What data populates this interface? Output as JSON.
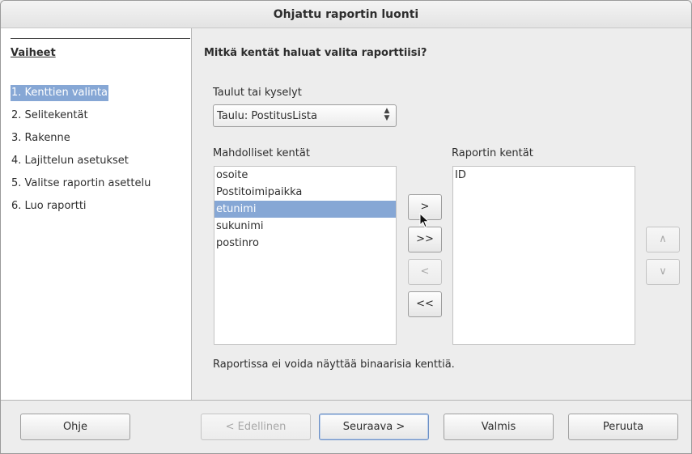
{
  "window": {
    "title": "Ohjattu raportin luonti"
  },
  "sidebar": {
    "title": "Vaiheet",
    "steps": [
      {
        "label": "1. Kenttien valinta",
        "active": true
      },
      {
        "label": "2. Selitekentät"
      },
      {
        "label": "3. Rakenne"
      },
      {
        "label": "4. Lajittelun asetukset"
      },
      {
        "label": "5. Valitse raportin asettelu"
      },
      {
        "label": "6. Luo raportti"
      }
    ]
  },
  "main": {
    "heading": "Mitkä kentät haluat valita raporttiisi?",
    "tables_label": "Taulut tai kyselyt",
    "tables_selected": "Taulu: PostitusLista",
    "available_label": "Mahdolliset kentät",
    "available_fields": [
      "osoite",
      "Postitoimipaikka",
      "etunimi",
      "sukunimi",
      "postinro"
    ],
    "available_selected": "etunimi",
    "report_label": "Raportin kentät",
    "report_fields": [
      "ID"
    ],
    "move_buttons": {
      "add": ">",
      "add_all": ">>",
      "remove": "<",
      "remove_all": "<<"
    },
    "order_buttons": {
      "up": "∧",
      "down": "∨"
    },
    "note": "Raportissa ei voida näyttää binaarisia kenttiä."
  },
  "footer": {
    "help": "Ohje",
    "back": "< Edellinen",
    "next": "Seuraava >",
    "finish": "Valmis",
    "cancel": "Peruuta"
  }
}
